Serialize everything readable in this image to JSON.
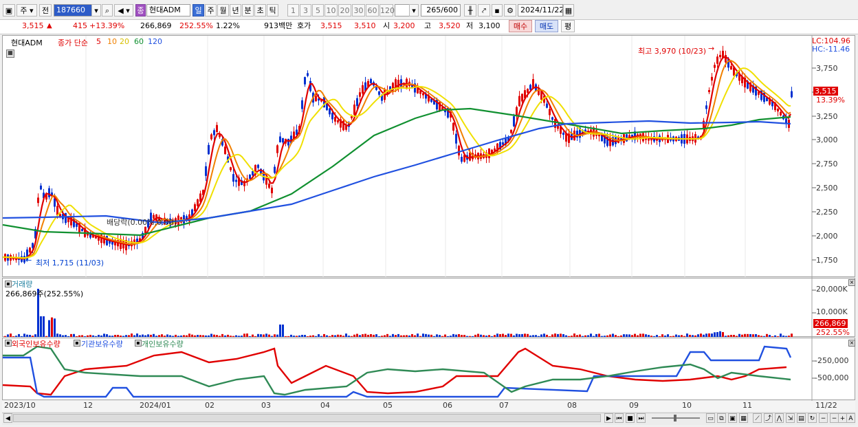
{
  "toolbar": {
    "type_main": "주",
    "type_prev": "전",
    "stock_code": "187660",
    "stock_name": "현대ADM",
    "stock_badge": "종",
    "periods": [
      "일",
      "주",
      "월",
      "년",
      "분",
      "초",
      "틱"
    ],
    "active_period": "일",
    "intervals": [
      "1",
      "3",
      "5",
      "10",
      "20",
      "30",
      "60",
      "120"
    ],
    "count_value": "265",
    "count_total": "/600",
    "date": "2024/11/22"
  },
  "quote": {
    "price": "3,515",
    "change": "415",
    "change_pct": "+13.39%",
    "volume": "266,869",
    "volume_pct": "252.55%",
    "turnover_pct": "1.22%",
    "amount": "913백만",
    "hoga_label": "호가",
    "ask": "3,515",
    "bid": "3,510",
    "open_label": "시",
    "open": "3,200",
    "high_label": "고",
    "high": "3,520",
    "low_label": "저",
    "low": "3,100",
    "buy_label": "매수",
    "sell_label": "매도",
    "avg_label": "평"
  },
  "price_panel": {
    "stock_tag": "현대ADM",
    "ma_label": "종가 단순",
    "ma_periods": [
      {
        "label": "5",
        "color": "#e00000"
      },
      {
        "label": "10",
        "color": "#f08000"
      },
      {
        "label": "20",
        "color": "#e8d800"
      },
      {
        "label": "60",
        "color": "#109030"
      },
      {
        "label": "120",
        "color": "#2050e0"
      }
    ],
    "lc": "LC:104.96",
    "hc": "HC:-11.46",
    "y_ticks": [
      "3,750",
      "3,500",
      "3,250",
      "3,000",
      "2,750",
      "2,500",
      "2,250",
      "2,000",
      "1,750"
    ],
    "current_price": "3,515",
    "current_pct": "13.39%",
    "annotation_high": "최고 3,970 (10/23)",
    "annotation_low": "최저 1,715 (11/03)",
    "annotation_div": "배당락(0.00%,0.00)"
  },
  "volume_panel": {
    "title": "거래량",
    "value_label": "266,869주(252.55%)",
    "y_ticks": [
      "20,000K",
      "10,000K"
    ],
    "current_value": "266,869",
    "current_pct": "252.55%"
  },
  "holding_panel": {
    "legends": [
      {
        "label": "외국인보유수량",
        "color": "#e00000"
      },
      {
        "label": "기관보유수량",
        "color": "#2050e0"
      },
      {
        "label": "개인보유수량",
        "color": "#2f8a55"
      }
    ],
    "y_ticks": [
      "-250,000",
      "-500,000"
    ]
  },
  "x_axis": [
    "2023/10",
    "12",
    "2024/01",
    "02",
    "03",
    "04",
    "05",
    "06",
    "07",
    "08",
    "09",
    "10",
    "11",
    "11/22"
  ],
  "colors": {
    "up": "#e00000",
    "down": "#0040d0",
    "ma5": "#e00000",
    "ma10": "#f08000",
    "ma20": "#f0e000",
    "ma60": "#109030",
    "ma120": "#2050e0"
  }
}
